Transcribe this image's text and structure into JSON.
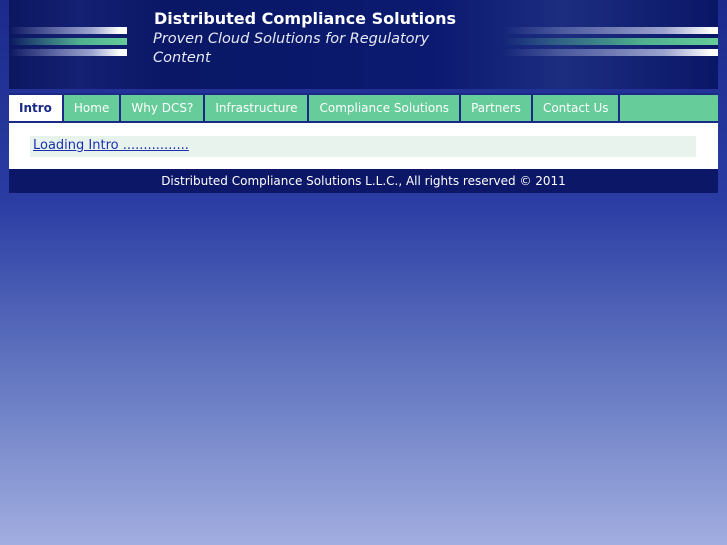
{
  "header": {
    "title": "Distributed Compliance Solutions",
    "tagline": "Proven Cloud Solutions for Regulatory Content"
  },
  "nav": {
    "tabs": [
      {
        "label": "Intro",
        "active": true
      },
      {
        "label": "Home",
        "active": false
      },
      {
        "label": "Why DCS?",
        "active": false
      },
      {
        "label": "Infrastructure",
        "active": false
      },
      {
        "label": "Compliance Solutions",
        "active": false
      },
      {
        "label": "Partners",
        "active": false
      },
      {
        "label": "Contact Us",
        "active": false
      }
    ]
  },
  "content": {
    "loading_link": "Loading Intro ................"
  },
  "footer": {
    "copyright": "Distributed Compliance Solutions L.L.C., All rights reserved © 2011"
  },
  "colors": {
    "header_bg": "#0b1a70",
    "nav_bg": "#66cc99",
    "accent_blue": "#1b2a86",
    "footer_bg": "#0d1768"
  }
}
